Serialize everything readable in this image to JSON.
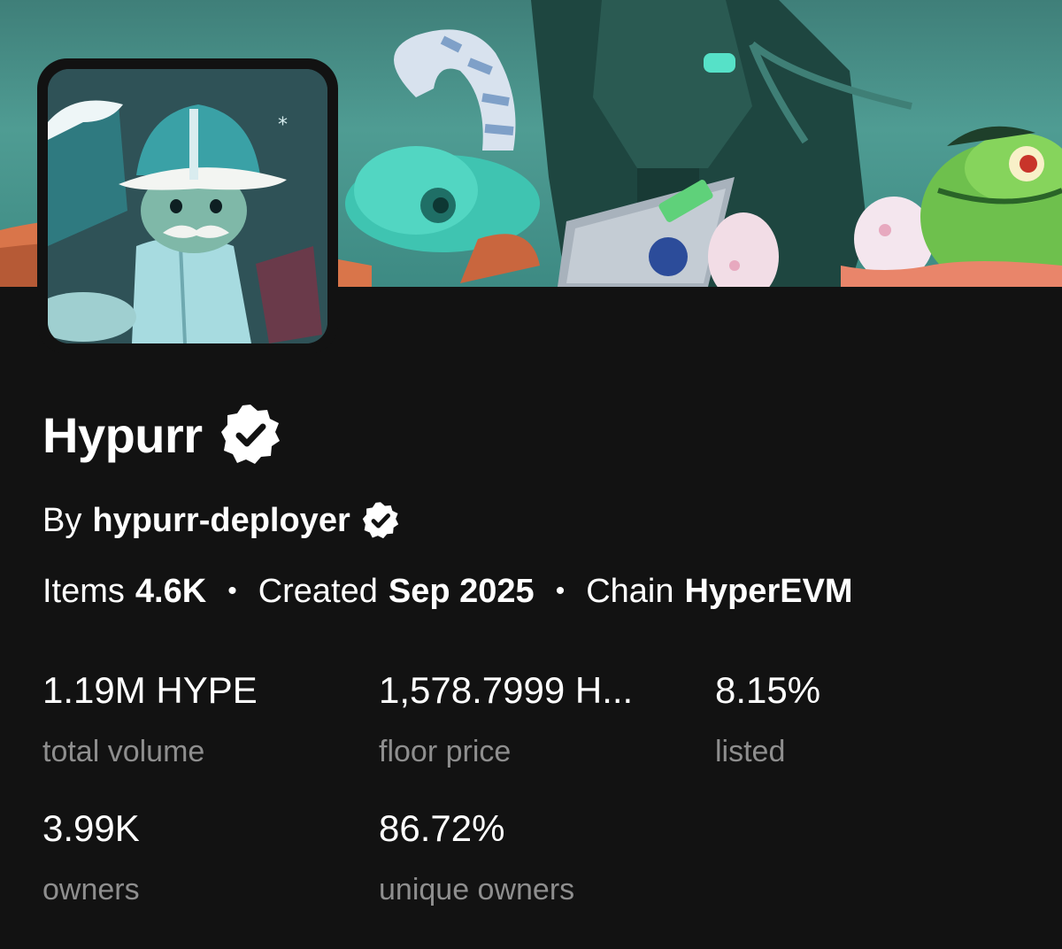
{
  "collection": {
    "name": "Hypurr",
    "verified_icon": "verified-badge-icon"
  },
  "creator": {
    "by_label": "By",
    "name": "hypurr-deployer",
    "verified_icon": "verified-badge-icon"
  },
  "meta": {
    "items_label": "Items",
    "items_value": "4.6K",
    "created_label": "Created",
    "created_value": "Sep 2025",
    "chain_label": "Chain",
    "chain_value": "HyperEVM",
    "separator": "•"
  },
  "stats": [
    {
      "value": "1.19M HYPE",
      "label": "total volume"
    },
    {
      "value": "1,578.7999 H...",
      "label": "floor price"
    },
    {
      "value": "8.15%",
      "label": "listed"
    },
    {
      "value": "3.99K",
      "label": "owners"
    },
    {
      "value": "86.72%",
      "label": "unique owners"
    }
  ],
  "colors": {
    "background": "#121212",
    "secondary_text": "#8e8e8e",
    "banner_teal": "#4f9c93"
  }
}
